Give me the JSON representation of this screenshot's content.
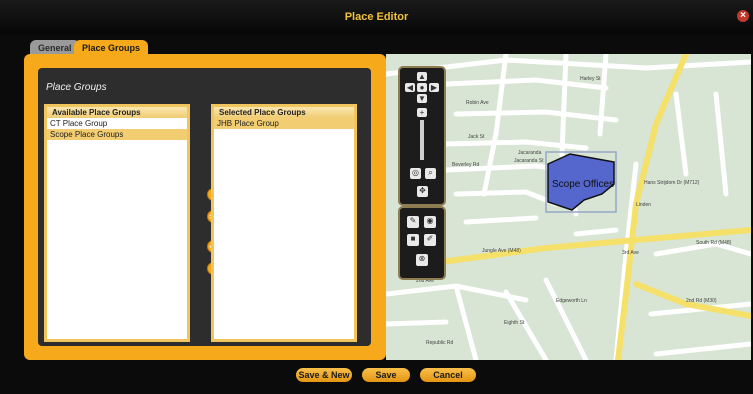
{
  "window": {
    "title": "Place Editor",
    "close_glyph": "×"
  },
  "tabs": [
    {
      "label": "General"
    },
    {
      "label": "Place Groups"
    }
  ],
  "place_groups": {
    "title": "Place Groups",
    "available": {
      "header": "Available Place Groups",
      "items": [
        "CT Place Group",
        "Scope Place Groups"
      ],
      "selected_index": 1
    },
    "selected": {
      "header": "Selected Place Groups",
      "items": [
        "JHB Place Group"
      ],
      "selected_index": 0
    }
  },
  "transfer_buttons": [
    {
      "name": "move-right-button",
      "glyph": ">"
    },
    {
      "name": "move-all-right-button",
      "glyph": ">>"
    },
    {
      "name": "move-all-left-button",
      "glyph": "<<"
    },
    {
      "name": "move-left-button",
      "glyph": "<"
    }
  ],
  "map": {
    "area_label": "Scope Offices",
    "street_labels": [
      "Robin Ave",
      "Jack St",
      "Jacaranda St",
      "Jacaranda",
      "Beverley Rd",
      "Linden",
      "Harley St",
      "Hans Strijdom Dr (M712)",
      "Jungle Ave (M48)",
      "3rd Ave",
      "South Rd (M48)",
      "2nd Ave",
      "Edgeworth Ln",
      "Eighth St",
      "2nd Rd (M30)",
      "Republic Rd"
    ]
  },
  "footer": {
    "save_new": "Save & New",
    "save": "Save",
    "cancel": "Cancel"
  },
  "colors": {
    "accent": "#f6a91a",
    "title_text": "#f3c23a",
    "map_area": "#5566cc"
  }
}
